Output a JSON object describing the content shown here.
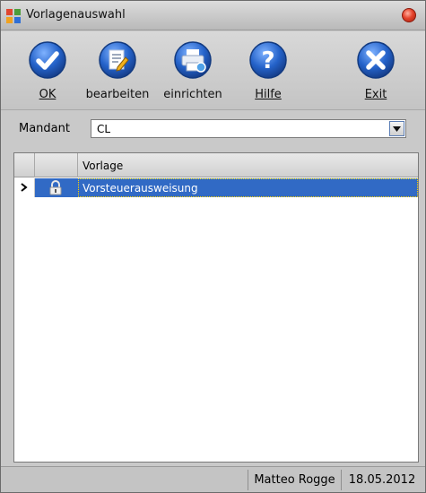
{
  "window": {
    "title": "Vorlagenauswahl"
  },
  "toolbar": {
    "buttons": [
      {
        "id": "ok",
        "label": "OK",
        "icon": "check-icon"
      },
      {
        "id": "bearbeiten",
        "label": "bearbeiten",
        "icon": "edit-document-icon"
      },
      {
        "id": "einrichten",
        "label": "einrichten",
        "icon": "printer-setup-icon"
      },
      {
        "id": "hilfe",
        "label": "Hilfe",
        "icon": "help-icon"
      },
      {
        "id": "exit",
        "label": "Exit",
        "icon": "close-icon"
      }
    ]
  },
  "mandant": {
    "label": "Mandant",
    "value": "CL"
  },
  "grid": {
    "columns": [
      "",
      "",
      "Vorlage"
    ],
    "rows": [
      {
        "vorlage": "Vorsteuerausweisung",
        "selected": true,
        "icon": "lock-icon"
      }
    ]
  },
  "statusbar": {
    "user": "Matteo Rogge",
    "date": "18.05.2012"
  },
  "colors": {
    "accent_blue": "#316ac5",
    "toolbar_icon_blue": "#1f5fbf",
    "close_red": "#e5432c"
  }
}
